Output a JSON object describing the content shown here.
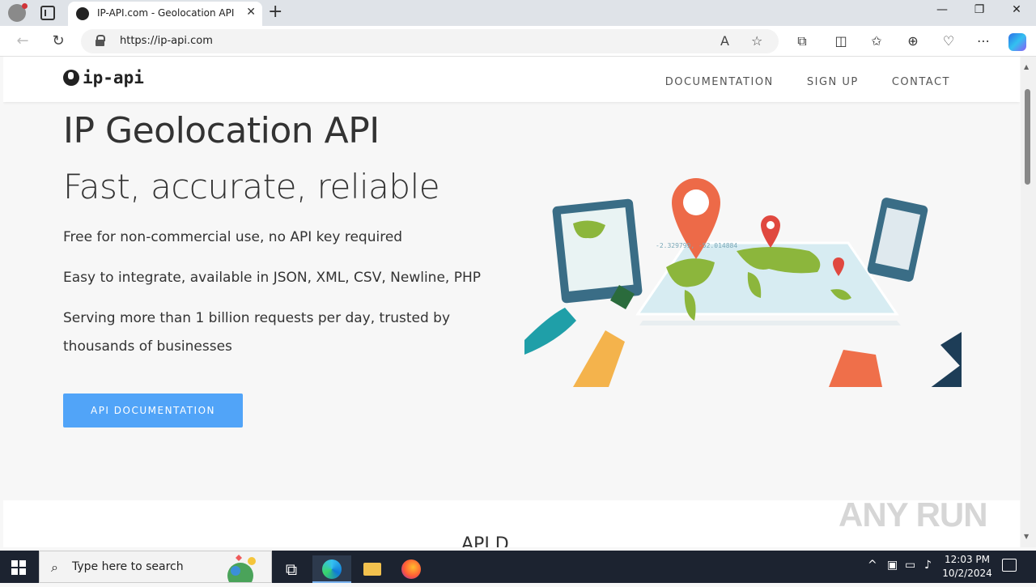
{
  "browser": {
    "tab_title": "IP-API.com - Geolocation API",
    "url": "https://ip-api.com"
  },
  "site": {
    "logo_text": "ip-api",
    "nav": [
      "DOCUMENTATION",
      "SIGN UP",
      "CONTACT"
    ],
    "hero_title": "IP Geolocation API",
    "hero_subtitle": "Fast, accurate, reliable",
    "hero_lines": [
      "Free for non-commercial use, no API key required",
      "Easy to integrate, available in JSON, XML, CSV, Newline, PHP",
      "Serving more than 1 billion requests per day, trusted by thousands of businesses"
    ],
    "cta_label": "API DOCUMENTATION",
    "map_coords": "-2.329799, -52.014884",
    "lower_heading": "API D"
  },
  "watermark": "ANY RUN",
  "taskbar": {
    "search_placeholder": "Type here to search",
    "time": "12:03 PM",
    "date": "10/2/2024"
  },
  "colors": {
    "cta": "#51a4f8",
    "taskbar": "#1c2330"
  }
}
